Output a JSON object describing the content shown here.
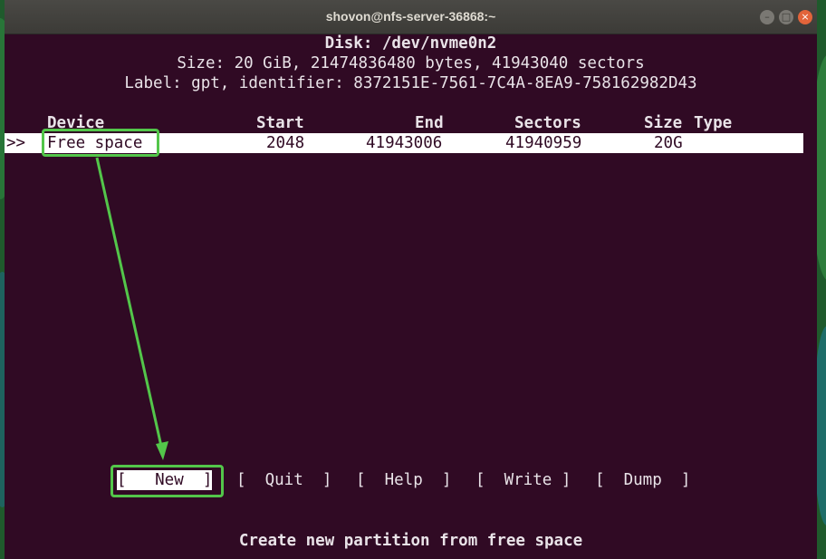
{
  "window": {
    "title": "shovon@nfs-server-36868:~",
    "buttons": [
      "–",
      "□",
      "×"
    ]
  },
  "disk": {
    "heading": "Disk: /dev/nvme0n2",
    "size_line": "Size: 20 GiB, 21474836480 bytes, 41943040 sectors",
    "label_line": "Label: gpt, identifier: 8372151E-7561-7C4A-8EA9-758162982D43"
  },
  "table": {
    "columns": [
      "Device",
      "Start",
      "End",
      "Sectors",
      "Size",
      "Type"
    ],
    "rows": [
      {
        "marker": ">>",
        "device": "Free space",
        "start": "2048",
        "end": "41943006",
        "sectors": "41940959",
        "size": "20G",
        "type": ""
      }
    ]
  },
  "menu": {
    "items": [
      {
        "label": "[   New  ]",
        "selected": true
      },
      {
        "label": "[  Quit  ]",
        "selected": false
      },
      {
        "label": "[  Help  ]",
        "selected": false
      },
      {
        "label": "[  Write ]",
        "selected": false
      },
      {
        "label": "[  Dump  ]",
        "selected": false
      }
    ]
  },
  "status": {
    "hint": "Create new partition from free space"
  },
  "colors": {
    "terminal_bg": "#300a24",
    "annotation": "#53c64a",
    "selection_bg": "#ffffff"
  }
}
